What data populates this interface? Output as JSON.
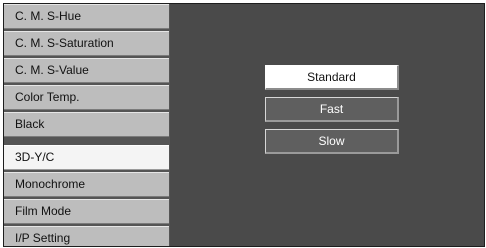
{
  "sidebar": {
    "items": [
      {
        "label": "C. M. S-Hue"
      },
      {
        "label": "C. M. S-Saturation"
      },
      {
        "label": "C. M. S-Value"
      },
      {
        "label": "Color Temp."
      },
      {
        "label": "Black"
      },
      {
        "label": "3D-Y/C"
      },
      {
        "label": "Monochrome"
      },
      {
        "label": "Film Mode"
      },
      {
        "label": "I/P Setting"
      }
    ],
    "selected": "3D-Y/C"
  },
  "options": {
    "items": [
      {
        "label": "Standard"
      },
      {
        "label": "Fast"
      },
      {
        "label": "Slow"
      }
    ],
    "selected": "Standard"
  },
  "colors": {
    "sidebar_item": "#bdbdbd",
    "sidebar_selected": "#f4f4f4",
    "content_background": "#4a4a4a",
    "option_active": "#ffffff",
    "option_inactive": "#5f5f5f"
  }
}
